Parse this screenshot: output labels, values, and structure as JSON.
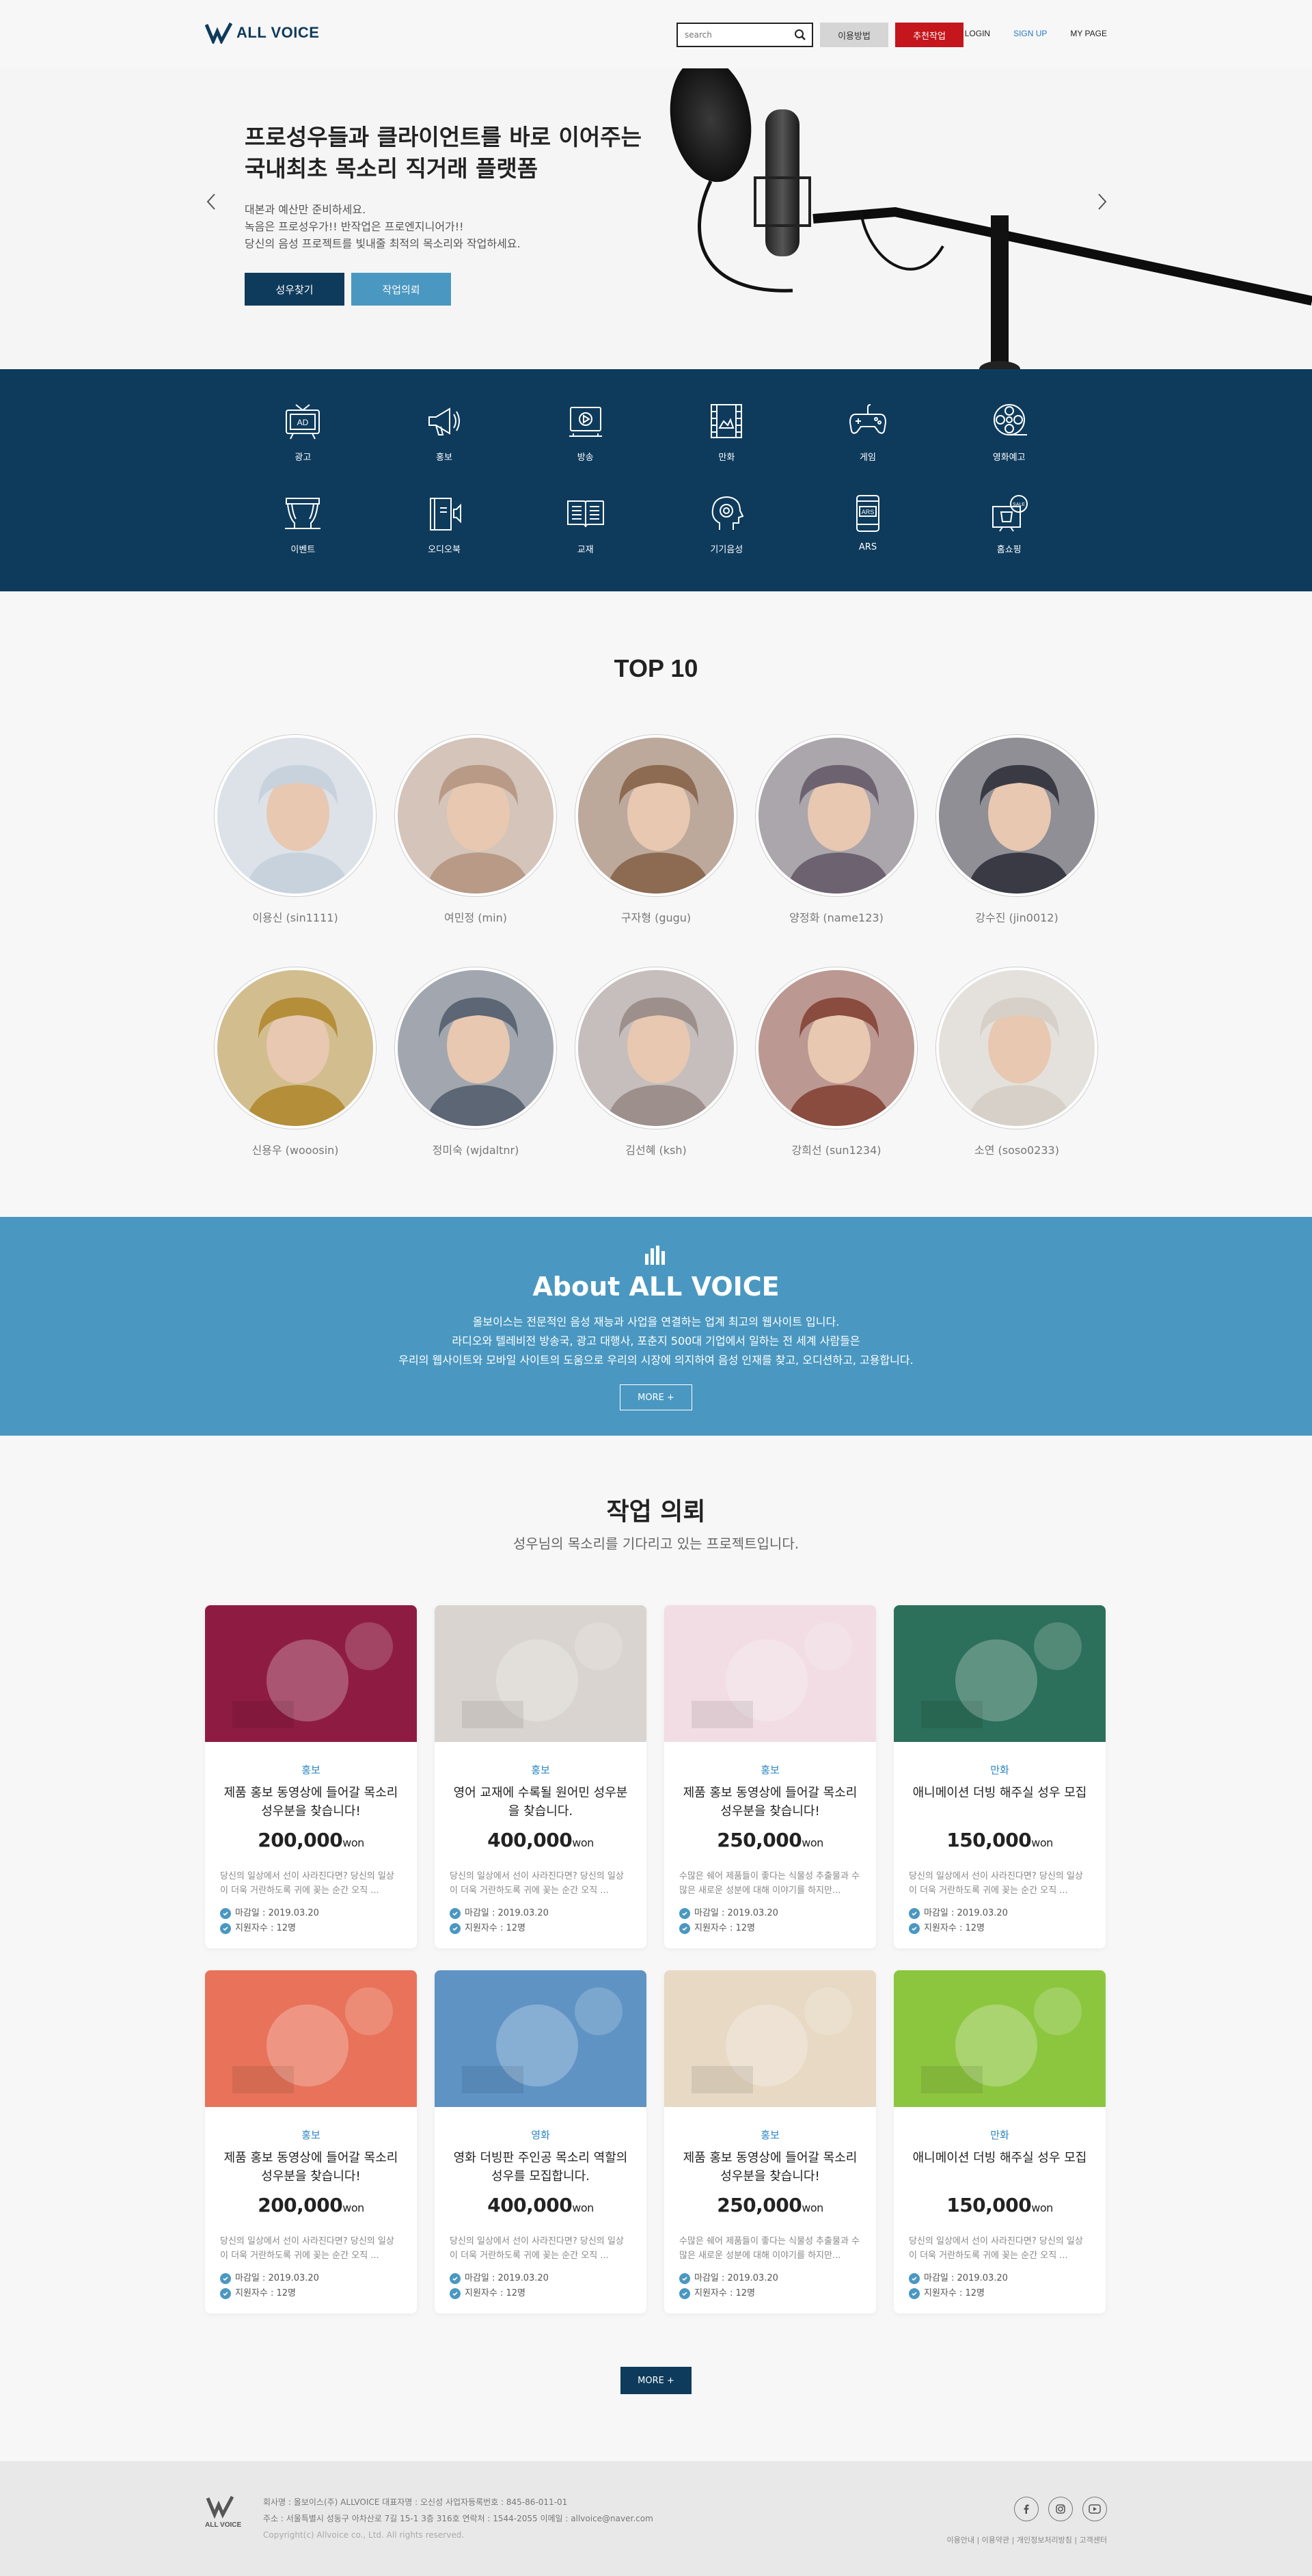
{
  "header": {
    "logo": "ALL VOICE",
    "search_placeholder": "search",
    "guide_label": "이용방법",
    "request_label": "추천작업",
    "links": [
      "LOGIN",
      "SIGN UP",
      "MY PAGE"
    ]
  },
  "hero": {
    "title_line1": "프로성우들과 클라이언트를 바로 이어주는",
    "title_line2": "국내최초 목소리 직거래 플랫폼",
    "sub1": "대본과 예산만 준비하세요.",
    "sub2": "녹음은 프로성우가!! 반작업은 프로엔지니어가!!",
    "sub3": "당신의 음성 프로젝트를 빛내줄 최적의 목소리와 작업하세요.",
    "btn1": "성우찾기",
    "btn2": "작업의뢰"
  },
  "categories": [
    "광고",
    "홍보",
    "방송",
    "만화",
    "게임",
    "영화예고",
    "이벤트",
    "오디오북",
    "교재",
    "기기음성",
    "ARS",
    "홈쇼핑"
  ],
  "top10": {
    "title": "TOP 10",
    "people": [
      {
        "name": "이용신 (sin1111)",
        "color": "#c7d2dc"
      },
      {
        "name": "여민정 (min)",
        "color": "#b89a86"
      },
      {
        "name": "구자형 (gugu)",
        "color": "#8d6a52"
      },
      {
        "name": "양정화 (name123)",
        "color": "#6d6270"
      },
      {
        "name": "강수진 (jin0012)",
        "color": "#3a3a45"
      },
      {
        "name": "신용우 (wooosin)",
        "color": "#b58e3a"
      },
      {
        "name": "정미숙 (wjdaltnr)",
        "color": "#5c6674"
      },
      {
        "name": "김선혜 (ksh)",
        "color": "#9c8f8c"
      },
      {
        "name": "강희선 (sun1234)",
        "color": "#8a4c3f"
      },
      {
        "name": "소연 (soso0233)",
        "color": "#d6d0c8"
      }
    ]
  },
  "about": {
    "title": "About ALL VOICE",
    "line1": "올보이스는 전문적인 음성 재능과 사업을 연결하는 업계 최고의 웹사이트 입니다.",
    "line2": "라디오와 텔레비전 방송국, 광고 대행사, 포춘지 500대 기업에서 일하는 전 세계 사람들은",
    "line3": "우리의 웹사이트와 모바일 사이트의 도움으로 우리의 시장에 의지하여 음성 인재를 찾고, 오디션하고, 고용합니다.",
    "more": "MORE +"
  },
  "jobs": {
    "title": "작업 의뢰",
    "subtitle": "성우님의 목소리를 기다리고 있는 프로젝트입니다.",
    "more": "MORE +",
    "cards": [
      {
        "cat": "홍보",
        "title": "제품 홍보 동영상에 들어갈 목소리 성우분을 찾습니다!",
        "price": "200,000",
        "unit": "won",
        "desc": "당신의 일상에서 선이 사라진다면? 당신의 일상이 더욱 거란하도록 귀에 꽂는 순간 오직 ...",
        "deadline": "마감일 : 2019.03.20",
        "applicants": "지원자수 : 12명",
        "thumb": "#8e1c42"
      },
      {
        "cat": "홍보",
        "title": "영어 교재에 수록될 원어민 성우분을 찾습니다.",
        "price": "400,000",
        "unit": "won",
        "desc": "당신의 일상에서 선이 사라진다면? 당신의 일상이 더욱 거란하도록 귀에 꽂는 순간 오직 ...",
        "deadline": "마감일 : 2019.03.20",
        "applicants": "지원자수 : 12명",
        "thumb": "#d9d4cf"
      },
      {
        "cat": "홍보",
        "title": "제품 홍보 동영상에 들어갈 목소리 성우분을 찾습니다!",
        "price": "250,000",
        "unit": "won",
        "desc": "수많은 쉐어 제품들이 좋다는 식물성 추출물과 수많은 새로운 성분에 대해 이야기를 하지만...",
        "deadline": "마감일 : 2019.03.20",
        "applicants": "지원자수 : 12명",
        "thumb": "#f1dde3"
      },
      {
        "cat": "만화",
        "title": "애니메이션 더빙 해주실 성우 모집",
        "price": "150,000",
        "unit": "won",
        "desc": "당신의 일상에서 선이 사라진다면? 당신의 일상이 더욱 거란하도록 귀에 꽂는 순간 오직 ...",
        "deadline": "마감일 : 2019.03.20",
        "applicants": "지원자수 : 12명",
        "thumb": "#2c6f5a"
      },
      {
        "cat": "홍보",
        "title": "제품 홍보 동영상에 들어갈 목소리 성우분을 찾습니다!",
        "price": "200,000",
        "unit": "won",
        "desc": "당신의 일상에서 선이 사라진다면? 당신의 일상이 더욱 거란하도록 귀에 꽂는 순간 오직 ...",
        "deadline": "마감일 : 2019.03.20",
        "applicants": "지원자수 : 12명",
        "thumb": "#e8735a"
      },
      {
        "cat": "영화",
        "title": "영화 더빙판 주인공 목소리 역할의 성우를 모집합니다.",
        "price": "400,000",
        "unit": "won",
        "desc": "당신의 일상에서 선이 사라진다면? 당신의 일상이 더욱 거란하도록 귀에 꽂는 순간 오직 ...",
        "deadline": "마감일 : 2019.03.20",
        "applicants": "지원자수 : 12명",
        "thumb": "#5f93c4"
      },
      {
        "cat": "홍보",
        "title": "제품 홍보 동영상에 들어갈 목소리 성우분을 찾습니다!",
        "price": "250,000",
        "unit": "won",
        "desc": "수많은 쉐어 제품들이 좋다는 식물성 추출물과 수많은 새로운 성분에 대해 이야기를 하지만...",
        "deadline": "마감일 : 2019.03.20",
        "applicants": "지원자수 : 12명",
        "thumb": "#e7d9c4"
      },
      {
        "cat": "만화",
        "title": "애니메이션 더빙 해주실 성우 모집",
        "price": "150,000",
        "unit": "won",
        "desc": "당신의 일상에서 선이 사라진다면? 당신의 일상이 더욱 거란하도록 귀에 꽂는 순간 오직 ...",
        "deadline": "마감일 : 2019.03.20",
        "applicants": "지원자수 : 12명",
        "thumb": "#8cc63f"
      }
    ]
  },
  "footer": {
    "line1": "회사명 : 올보이스(주) ALLVOICE  대표자명 : 오신성  사업자등록번호 : 845-86-011-01",
    "line2": "주소 : 서울특별시 성동구 아차산로 7길 15-1 3층 316호  연락처 : 1544-2055  이메일 : allvoice@naver.com",
    "copyright": "Copyright(c) Allvoice co., Ltd. All rights reserved.",
    "links": "이용안내  |  이용약관  |  개인정보처리방침  |  고객센터",
    "logo": "ALL VOICE"
  },
  "colors": {
    "navy": "#0e3b5c",
    "blue": "#4a98c1",
    "red": "#c4161c",
    "link": "#2a86c4"
  }
}
